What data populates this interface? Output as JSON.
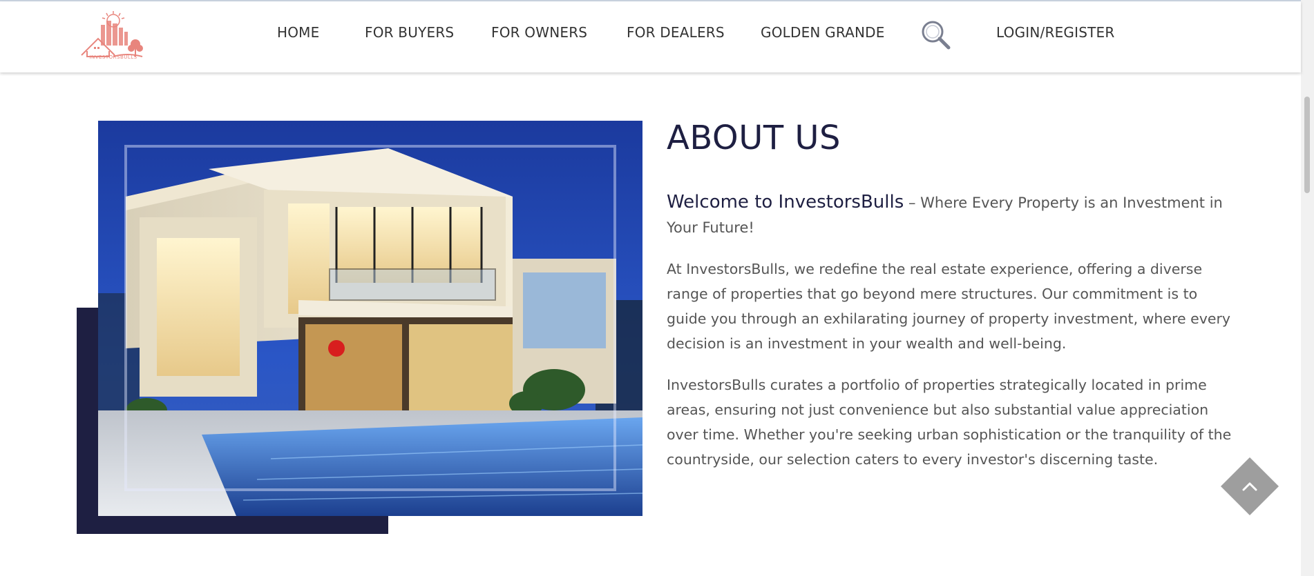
{
  "logo": {
    "text": "INVESTORSBULLS",
    "brand_color": "#e8857d"
  },
  "nav": {
    "items": [
      {
        "label": "HOME"
      },
      {
        "label": "FOR BUYERS"
      },
      {
        "label": "FOR OWNERS"
      },
      {
        "label": "FOR DEALERS"
      },
      {
        "label": "GOLDEN GRANDE"
      }
    ],
    "search_icon": "search-icon",
    "login_label": "LOGIN/REGISTER"
  },
  "about": {
    "title": "ABOUT US",
    "welcome_strong": "Welcome to InvestorsBulls",
    "welcome_rest": " – Where Every Property is an Investment in Your Future!",
    "paragraphs": [
      "At InvestorsBulls, we redefine the real estate experience, offering a diverse range of properties that go beyond mere structures. Our commitment is to guide you through an exhilarating journey of property investment, where every decision is an investment in your wealth and well-being.",
      "InvestorsBulls curates a portfolio of properties strategically located in prime areas, ensuring not just convenience but also substantial value appreciation over time. Whether you're seeking urban sophistication or the tranquility of the countryside, our selection caters to every investor's discerning taste."
    ]
  },
  "colors": {
    "navy": "#1e1f42",
    "text": "#555555",
    "back_to_top": "#9e9e9e"
  },
  "back_to_top_icon": "chevron-up-icon"
}
